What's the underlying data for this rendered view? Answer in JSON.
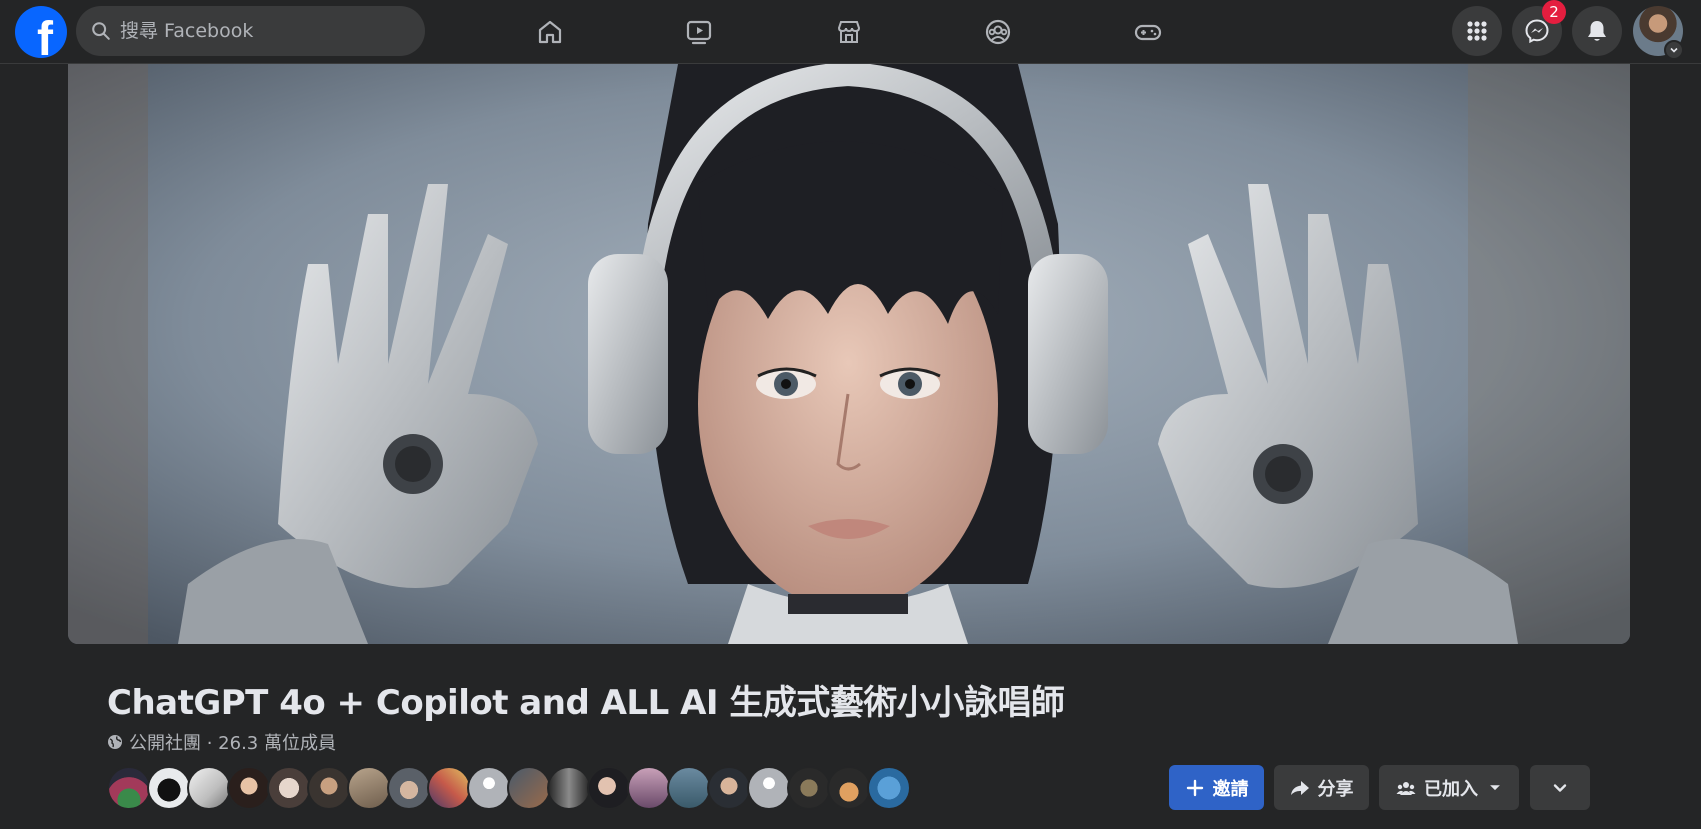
{
  "topbar": {
    "logo_letter": "f",
    "search_placeholder": "搜尋 Facebook",
    "nav_icons": [
      "home-icon",
      "video-icon",
      "marketplace-icon",
      "groups-icon",
      "gaming-icon"
    ],
    "menu_icon": "grid-menu-icon",
    "messenger_badge": "2",
    "notifications_icon": "bell-icon"
  },
  "group": {
    "title": "ChatGPT 4o + Copilot and ALL AI 生成式藝術小小詠唱師",
    "meta": "公開社團 · 26.3 萬位成員",
    "member_avatar_count": 20
  },
  "actions": {
    "invite_label": "邀請",
    "share_label": "分享",
    "joined_label": "已加入"
  },
  "colors": {
    "background": "#242526",
    "surface": "#3a3b3c",
    "accent": "#2f63c7",
    "brand": "#0866ff",
    "badge": "#e41e3f"
  }
}
